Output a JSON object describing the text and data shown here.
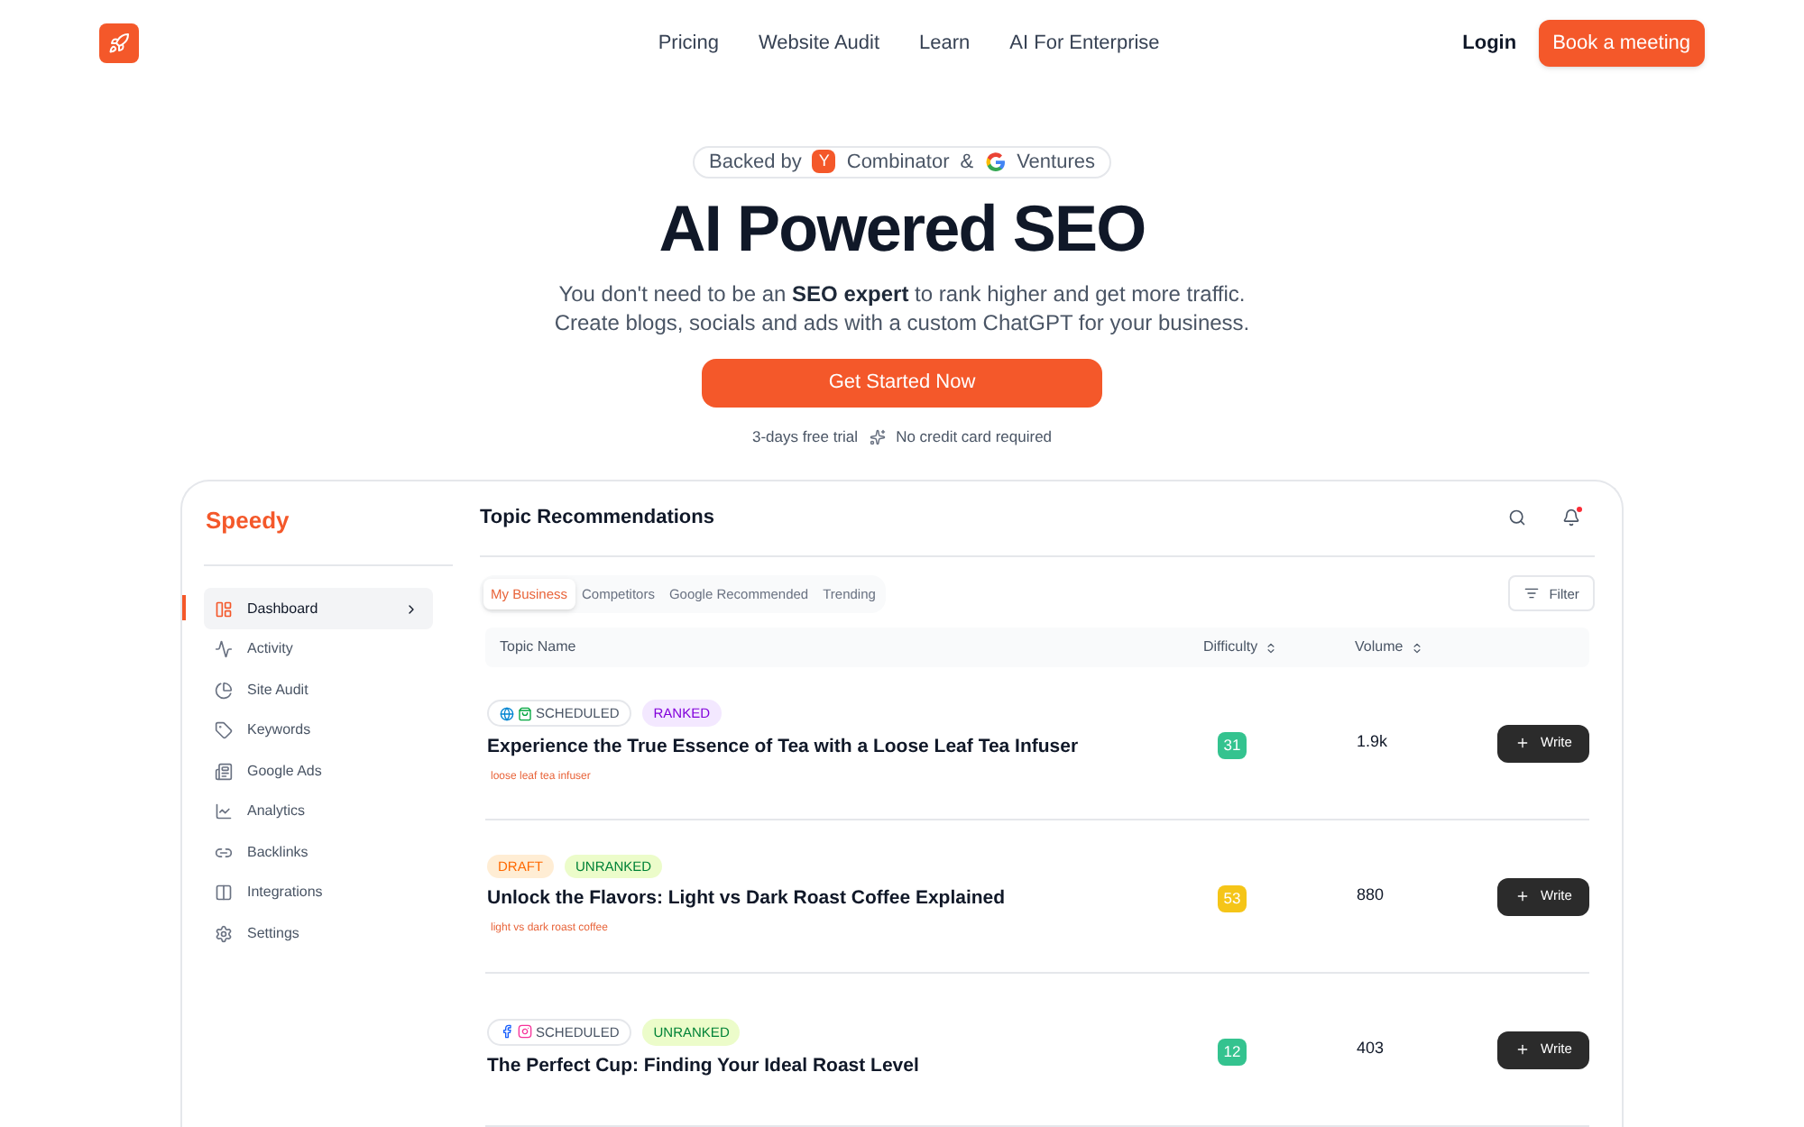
{
  "nav": {
    "links": [
      {
        "label": "Pricing"
      },
      {
        "label": "Website Audit"
      },
      {
        "label": "Learn"
      },
      {
        "label": "AI For Enterprise"
      }
    ],
    "login": "Login",
    "cta": "Book a meeting"
  },
  "hero": {
    "backed": {
      "prefix": "Backed by",
      "yc_mark": "Y",
      "yc": "Combinator",
      "amp": "&",
      "google": "Ventures"
    },
    "title": "AI Powered SEO",
    "subtitle": [
      "You don't need to be an **SEO expert** to rank higher and get more traffic.",
      "Create blogs, socials and ads with a custom ChatGPT for your business."
    ],
    "cta": "Get Started Now",
    "notes": [
      "3-days free trial",
      "No credit card required"
    ]
  },
  "app": {
    "logo": "Speedy",
    "sidebar": [
      {
        "label": "Dashboard",
        "selected": true
      },
      {
        "label": "Activity",
        "selected": false
      },
      {
        "label": "Site Audit",
        "selected": false
      },
      {
        "label": "Keywords",
        "selected": false
      },
      {
        "label": "Google Ads",
        "selected": false
      },
      {
        "label": "Analytics",
        "selected": false
      },
      {
        "label": "Backlinks",
        "selected": false
      },
      {
        "label": "Integrations",
        "selected": false
      },
      {
        "label": "Settings",
        "selected": false
      }
    ],
    "title": "Topic Recommendations",
    "notification": true,
    "tabs": [
      {
        "label": "My Business",
        "selected": true
      },
      {
        "label": "Competitors",
        "selected": false
      },
      {
        "label": "Google Recommended",
        "selected": false
      },
      {
        "label": "Trending",
        "selected": false
      }
    ],
    "filter": "Filter",
    "columns": [
      "Topic Name",
      "Difficulty",
      "Volume"
    ],
    "rows": [
      {
        "tags": [
          {
            "kind": "scheduled",
            "label": "SCHEDULED",
            "icons": [
              {
                "kind": "globe"
              },
              {
                "kind": "bag"
              }
            ]
          },
          {
            "kind": "ranked",
            "label": "RANKED"
          }
        ],
        "title": "Experience the True Essence of Tea with a Loose Leaf Tea Infuser",
        "keyword": "loose leaf tea infuser",
        "difficulty": "31",
        "color": "#34c38f",
        "volume": "1.9k",
        "action": "Write"
      },
      {
        "tags": [
          {
            "kind": "draft",
            "label": "DRAFT"
          },
          {
            "kind": "unranked",
            "label": "UNRANKED"
          }
        ],
        "title": "Unlock the Flavors: Light vs Dark Roast Coffee Explained",
        "keyword": "light vs dark roast coffee",
        "difficulty": "53",
        "color": "#f5c518",
        "volume": "880",
        "action": "Write"
      },
      {
        "tags": [
          {
            "kind": "scheduled",
            "label": "SCHEDULED",
            "icons": [
              {
                "kind": "f-circle"
              },
              {
                "kind": "camera"
              }
            ]
          },
          {
            "kind": "unranked",
            "label": "UNRANKED"
          }
        ],
        "title": "The Perfect Cup: Finding Your Ideal Roast Level",
        "difficulty": "12",
        "color": "#34c38f",
        "volume": "403",
        "action": "Write"
      }
    ]
  }
}
